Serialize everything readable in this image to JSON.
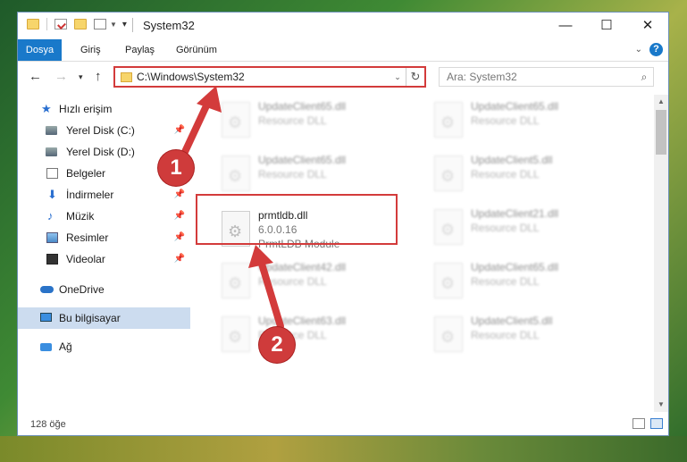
{
  "window": {
    "title": "System32"
  },
  "ribbon": {
    "tabs": [
      "Dosya",
      "Giriş",
      "Paylaş",
      "Görünüm"
    ]
  },
  "address": {
    "path": "C:\\Windows\\System32"
  },
  "search": {
    "placeholder": "Ara: System32"
  },
  "navpane": {
    "items": [
      {
        "label": "Hızlı erişim",
        "icon": "star-icon"
      },
      {
        "label": "Yerel Disk (C:)",
        "icon": "drive-icon",
        "pinned": true
      },
      {
        "label": "Yerel Disk (D:)",
        "icon": "drive-icon"
      },
      {
        "label": "Belgeler",
        "icon": "document-icon"
      },
      {
        "label": "İndirmeler",
        "icon": "download-icon",
        "pinned": true
      },
      {
        "label": "Müzik",
        "icon": "music-icon",
        "pinned": true
      },
      {
        "label": "Resimler",
        "icon": "pictures-icon",
        "pinned": true
      },
      {
        "label": "Videolar",
        "icon": "video-icon",
        "pinned": true
      },
      {
        "label": "OneDrive",
        "icon": "cloud-icon"
      },
      {
        "label": "Bu bilgisayar",
        "icon": "computer-icon",
        "selected": true
      },
      {
        "label": "Ağ",
        "icon": "network-icon"
      }
    ]
  },
  "files": {
    "left": [
      {
        "name": "UpdateClient65.dll",
        "desc": "Resource DLL"
      },
      {
        "name": "UpdateClient65.dll",
        "desc": "Resource DLL"
      },
      {
        "name": "prmtldb.dll",
        "desc": "6.0.0.16",
        "sub": "PrmtLDB Module"
      },
      {
        "name": "UpdateClient42.dll",
        "desc": "Resource DLL"
      },
      {
        "name": "UpdateClient63.dll",
        "desc": "Resource DLL"
      }
    ],
    "right": [
      {
        "name": "UpdateClient65.dll",
        "desc": "Resource DLL"
      },
      {
        "name": "UpdateClient5.dll",
        "desc": "Resource DLL"
      },
      {
        "name": "UpdateClient21.dll",
        "desc": "Resource DLL"
      },
      {
        "name": "UpdateClient65.dll",
        "desc": "Resource DLL"
      },
      {
        "name": "UpdateClient5.dll",
        "desc": "Resource DLL"
      }
    ]
  },
  "status": {
    "count": "128 öğe"
  },
  "annotations": {
    "badge1": "1",
    "badge2": "2",
    "color": "#cf3b3b"
  }
}
